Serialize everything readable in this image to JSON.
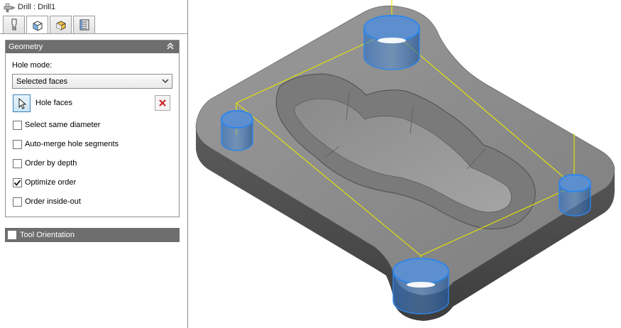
{
  "window": {
    "title": "Drill : Drill1",
    "title_icon": "drill-icon"
  },
  "tabs": [
    {
      "name": "tool",
      "icon": "tool-icon",
      "active": false
    },
    {
      "name": "geometry",
      "icon": "geometry-cube-icon",
      "active": true
    },
    {
      "name": "heights",
      "icon": "heights-icon",
      "active": false
    },
    {
      "name": "cycle",
      "icon": "cycle-icon",
      "active": false
    }
  ],
  "geometry": {
    "header": "Geometry",
    "hole_mode_label": "Hole mode:",
    "hole_mode_value": "Selected faces",
    "hole_faces_label": "Hole faces",
    "options": [
      {
        "label": "Select same diameter",
        "checked": false
      },
      {
        "label": "Auto-merge hole segments",
        "checked": false
      },
      {
        "label": "Order by depth",
        "checked": false
      },
      {
        "label": "Optimize order",
        "checked": true
      },
      {
        "label": "Order inside-out",
        "checked": false
      }
    ]
  },
  "tool_orientation": {
    "header": "Tool Orientation",
    "checked": false
  },
  "colors": {
    "group_header": "#6e6e6e",
    "selection_blue": "#2f86e8",
    "toolpath_yellow": "#e8e800",
    "part_top": "#8c8c8c",
    "clear_red": "#cc1f1f"
  }
}
